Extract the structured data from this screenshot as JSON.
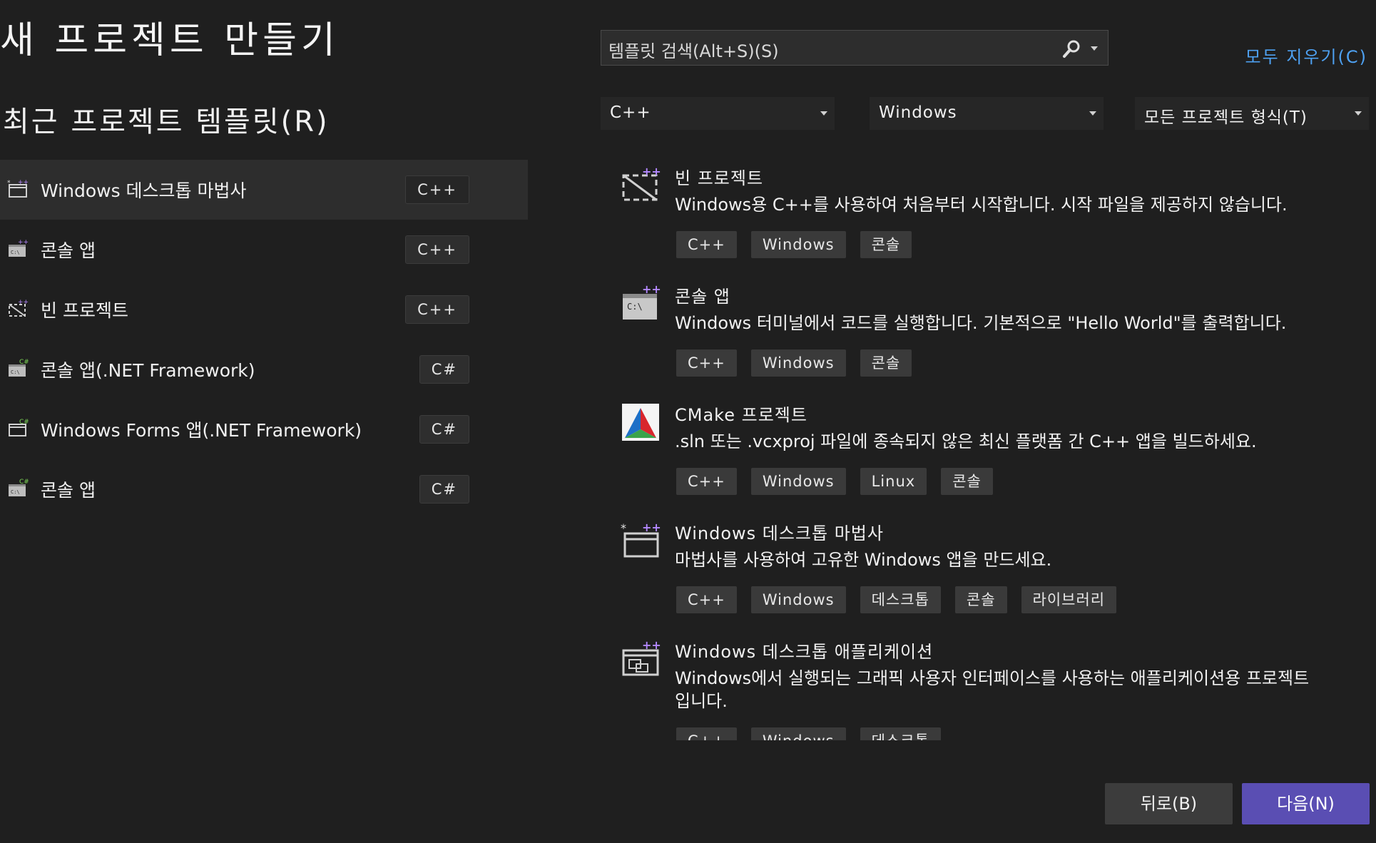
{
  "page": {
    "title": "새 프로젝트 만들기",
    "recent_heading": "최근 프로젝트 템플릿(R)"
  },
  "recent": [
    {
      "label": "Windows 데스크톱 마법사",
      "lang": "C++",
      "icon": "desktop-wizard-icon",
      "selected": true
    },
    {
      "label": "콘솔 앱",
      "lang": "C++",
      "icon": "console-app-icon"
    },
    {
      "label": "빈 프로젝트",
      "lang": "C++",
      "icon": "empty-project-icon"
    },
    {
      "label": "콘솔 앱(.NET Framework)",
      "lang": "C#",
      "icon": "console-app-csharp-icon"
    },
    {
      "label": "Windows Forms 앱(.NET Framework)",
      "lang": "C#",
      "icon": "windows-forms-icon"
    },
    {
      "label": "콘솔 앱",
      "lang": "C#",
      "icon": "console-app-csharp-icon"
    }
  ],
  "search": {
    "placeholder": "템플릿 검색(Alt+S)(S)",
    "icon": "search-icon"
  },
  "clear_all": "모두 지우기(C)",
  "filters": {
    "language": "C++",
    "platform": "Windows",
    "project_type": "모든 프로젝트 형식(T)"
  },
  "results": [
    {
      "title": "빈 프로젝트",
      "desc": "Windows용 C++를 사용하여 처음부터 시작합니다. 시작 파일을 제공하지 않습니다.",
      "tags": [
        "C++",
        "Windows",
        "콘솔"
      ],
      "icon": "empty-project-icon"
    },
    {
      "title": "콘솔 앱",
      "desc": "Windows 터미널에서 코드를 실행합니다. 기본적으로 \"Hello World\"를 출력합니다.",
      "tags": [
        "C++",
        "Windows",
        "콘솔"
      ],
      "icon": "console-app-icon"
    },
    {
      "title": "CMake 프로젝트",
      "desc": ".sln 또는 .vcxproj 파일에 종속되지 않은 최신 플랫폼 간 C++ 앱을 빌드하세요.",
      "tags": [
        "C++",
        "Windows",
        "Linux",
        "콘솔"
      ],
      "icon": "cmake-icon"
    },
    {
      "title": "Windows 데스크톱 마법사",
      "desc": "마법사를 사용하여 고유한 Windows 앱을 만드세요.",
      "tags": [
        "C++",
        "Windows",
        "데스크톱",
        "콘솔",
        "라이브러리"
      ],
      "icon": "desktop-wizard-icon"
    },
    {
      "title": "Windows 데스크톱 애플리케이션",
      "desc": "Windows에서 실행되는 그래픽 사용자 인터페이스를 사용하는 애플리케이션용 프로젝트입니다.",
      "tags": [
        "C++",
        "Windows",
        "데스크톱"
      ],
      "icon": "desktop-app-icon"
    }
  ],
  "buttons": {
    "back": "뒤로(B)",
    "next": "다음(N)"
  },
  "colors": {
    "accent": "#5a4eb3",
    "link": "#4ea1f2",
    "background": "#1f1f1f"
  }
}
